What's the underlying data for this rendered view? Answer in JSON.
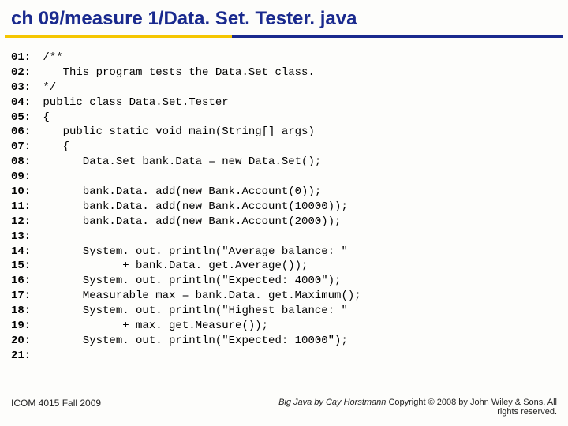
{
  "title": "ch 09/measure 1/Data. Set. Tester. java",
  "code_lines": [
    {
      "n": "01:",
      "t": "/**"
    },
    {
      "n": "02:",
      "t": "   This program tests the Data.Set class."
    },
    {
      "n": "03:",
      "t": "*/"
    },
    {
      "n": "04:",
      "t": "public class Data.Set.Tester"
    },
    {
      "n": "05:",
      "t": "{"
    },
    {
      "n": "06:",
      "t": "   public static void main(String[] args)"
    },
    {
      "n": "07:",
      "t": "   {"
    },
    {
      "n": "08:",
      "t": "      Data.Set bank.Data = new Data.Set();"
    },
    {
      "n": "09:",
      "t": ""
    },
    {
      "n": "10:",
      "t": "      bank.Data. add(new Bank.Account(0));"
    },
    {
      "n": "11:",
      "t": "      bank.Data. add(new Bank.Account(10000));"
    },
    {
      "n": "12:",
      "t": "      bank.Data. add(new Bank.Account(2000));"
    },
    {
      "n": "13:",
      "t": ""
    },
    {
      "n": "14:",
      "t": "      System. out. println(\"Average balance: \""
    },
    {
      "n": "15:",
      "t": "            + bank.Data. get.Average());"
    },
    {
      "n": "16:",
      "t": "      System. out. println(\"Expected: 4000\");"
    },
    {
      "n": "17:",
      "t": "      Measurable max = bank.Data. get.Maximum();"
    },
    {
      "n": "18:",
      "t": "      System. out. println(\"Highest balance: \""
    },
    {
      "n": "19:",
      "t": "            + max. get.Measure());"
    },
    {
      "n": "20:",
      "t": "      System. out. println(\"Expected: 10000\");"
    },
    {
      "n": "21:",
      "t": ""
    }
  ],
  "footer": {
    "left": "ICOM 4015 Fall 2009",
    "right_italic": "Big Java by Cay Horstmann ",
    "right_plain": "Copyright © 2008 by John Wiley & Sons.  All rights reserved."
  }
}
